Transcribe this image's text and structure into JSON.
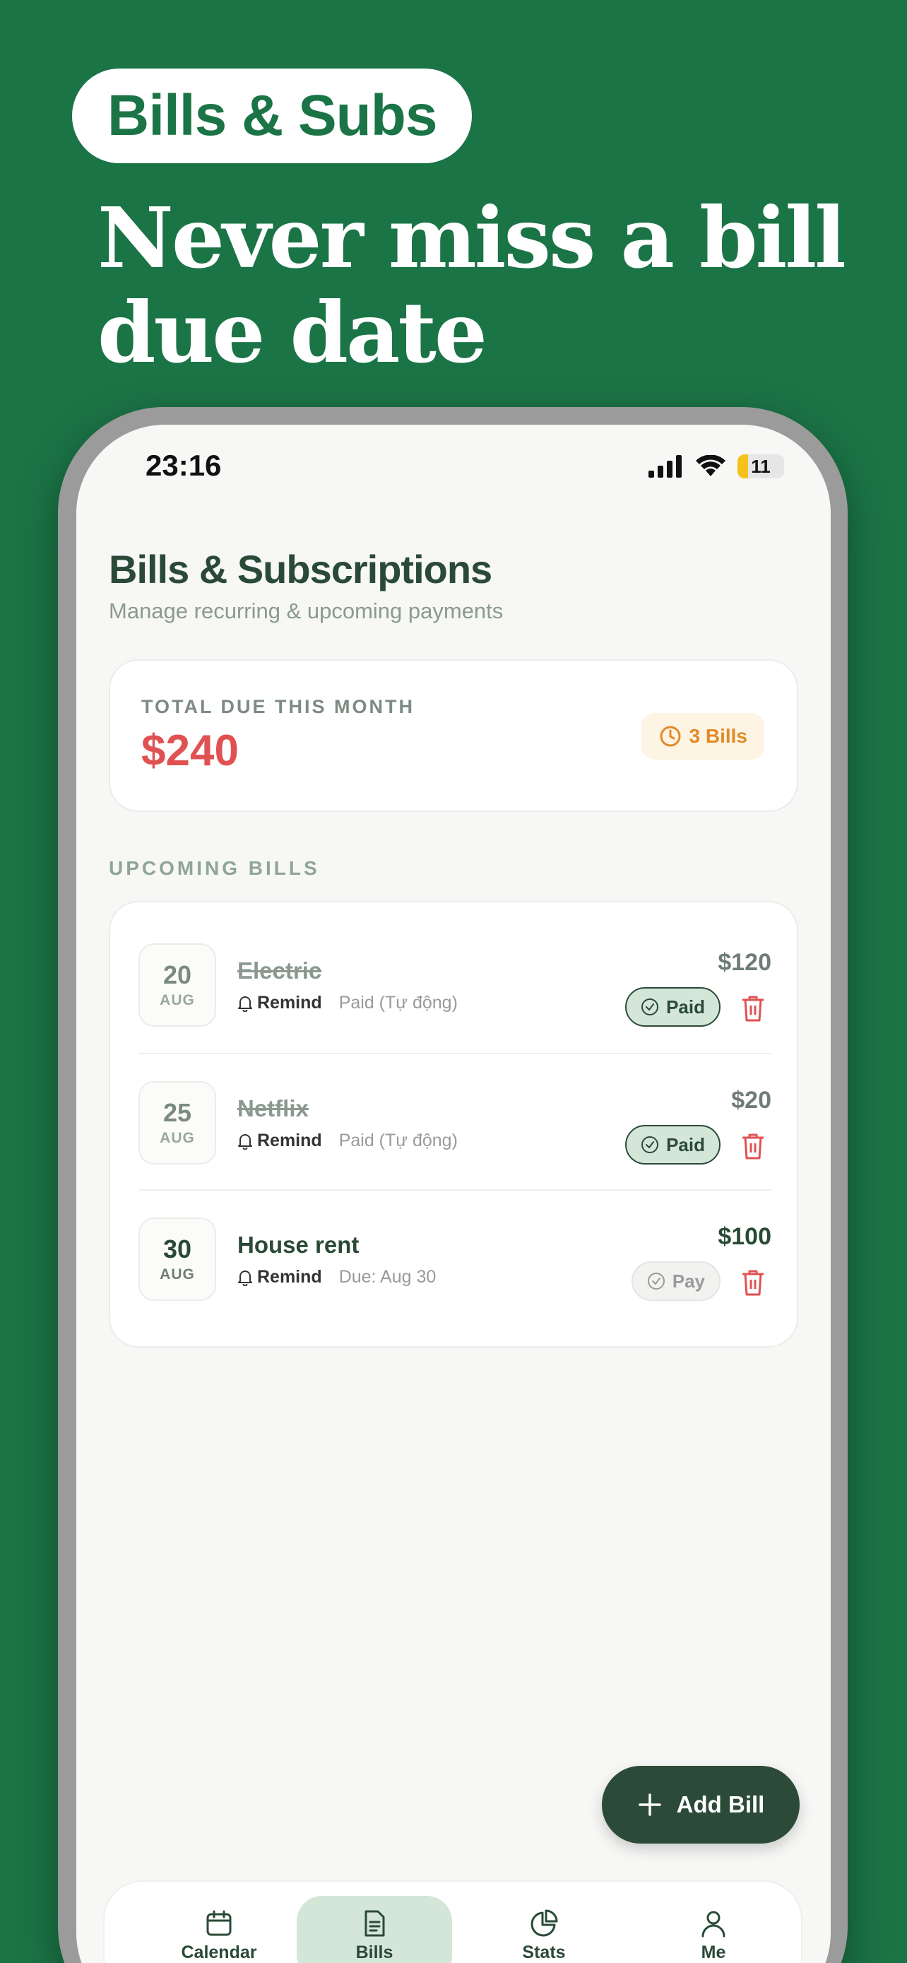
{
  "promo": {
    "pill": "Bills & Subs",
    "headline_line1": "Never miss a bill",
    "headline_line2": "due date"
  },
  "status_bar": {
    "time": "23:16",
    "battery": "11"
  },
  "header": {
    "title": "Bills & Subscriptions",
    "subtitle": "Manage recurring & upcoming payments"
  },
  "summary": {
    "label": "TOTAL DUE THIS MONTH",
    "amount": "$240",
    "badge": "3 Bills"
  },
  "section": {
    "label": "UPCOMING BILLS"
  },
  "bills": [
    {
      "day": "20",
      "month": "AUG",
      "name": "Electric",
      "remind": "Remind",
      "status": "Paid (Tự động)",
      "amount": "$120",
      "action": "Paid",
      "paid": true
    },
    {
      "day": "25",
      "month": "AUG",
      "name": "Netflix",
      "remind": "Remind",
      "status": "Paid (Tự động)",
      "amount": "$20",
      "action": "Paid",
      "paid": true
    },
    {
      "day": "30",
      "month": "AUG",
      "name": "House rent",
      "remind": "Remind",
      "status": "Due: Aug 30",
      "amount": "$100",
      "action": "Pay",
      "paid": false
    }
  ],
  "fab": {
    "label": "Add Bill"
  },
  "nav": {
    "items": [
      {
        "label": "Calendar",
        "icon": "calendar-icon"
      },
      {
        "label": "Bills",
        "icon": "document-icon",
        "active": true
      },
      {
        "label": "Stats",
        "icon": "pie-chart-icon"
      },
      {
        "label": "Me",
        "icon": "user-icon"
      }
    ]
  },
  "colors": {
    "brand_green": "#1b7446",
    "dark_green": "#2c4a38",
    "due_red": "#e05252",
    "badge_orange": "#e38a28",
    "paid_bg": "#d4e6d8"
  }
}
